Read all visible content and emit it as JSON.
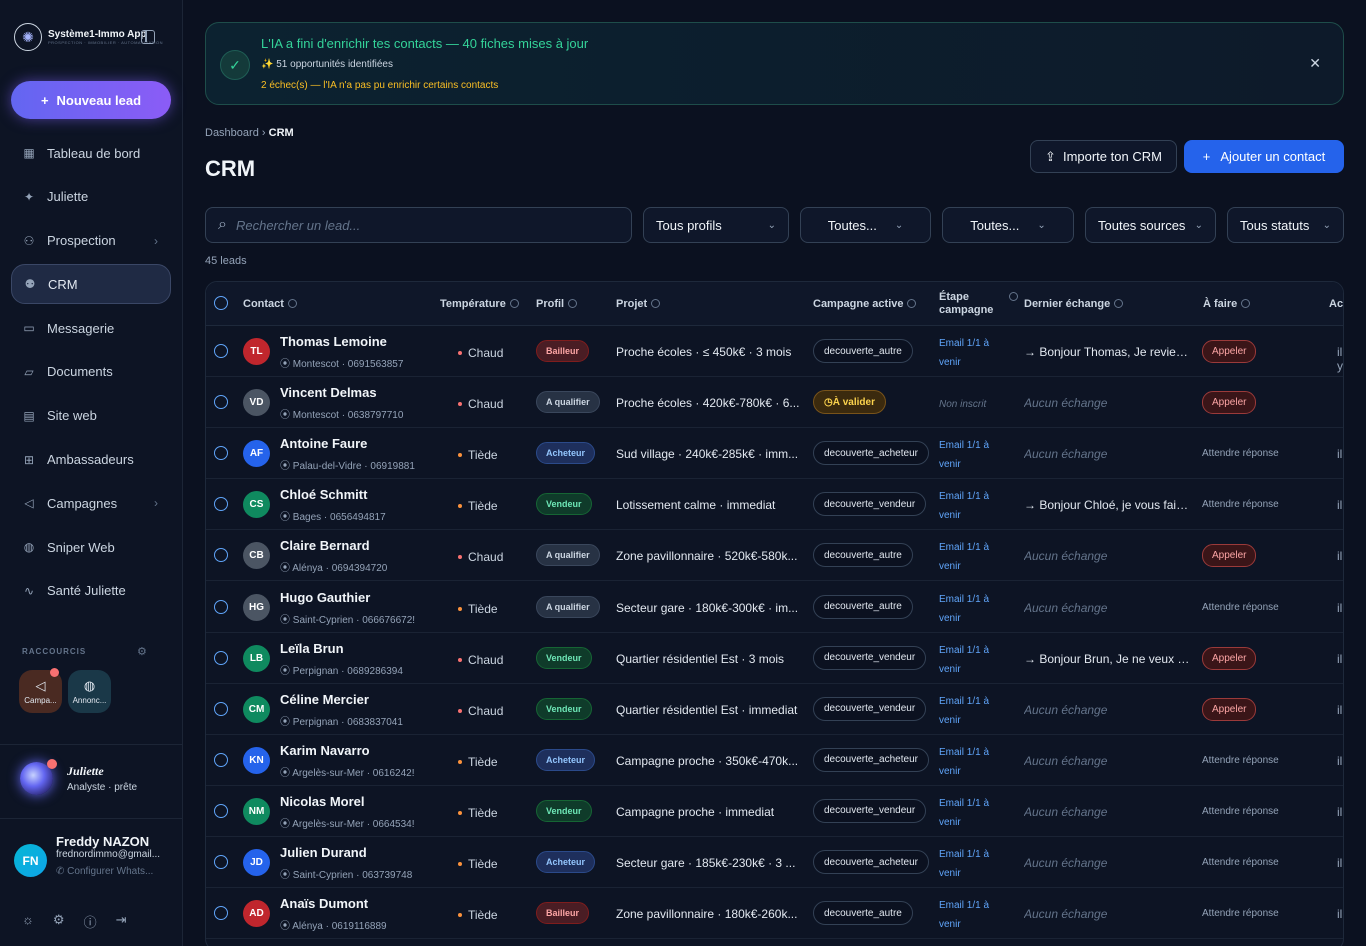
{
  "app": {
    "name": "Système1-Immo App",
    "tagline": "PROSPECTION · IMMOBILIER · AUTOMATISATION"
  },
  "sidebar": {
    "new_lead": "Nouveau lead",
    "items": [
      {
        "label": "Tableau de bord",
        "icon": "grid-icon"
      },
      {
        "label": "Juliette",
        "icon": "sparkle-icon"
      },
      {
        "label": "Prospection",
        "icon": "user-plus-icon"
      },
      {
        "label": "CRM",
        "icon": "users-icon"
      },
      {
        "label": "Messagerie",
        "icon": "message-icon"
      },
      {
        "label": "Documents",
        "icon": "folder-icon"
      },
      {
        "label": "Site web",
        "icon": "layout-icon"
      },
      {
        "label": "Ambassadeurs",
        "icon": "gift-icon"
      },
      {
        "label": "Campagnes",
        "icon": "megaphone-icon"
      },
      {
        "label": "Sniper Web",
        "icon": "globe-icon"
      },
      {
        "label": "Santé Juliette",
        "icon": "activity-icon"
      }
    ],
    "shortcuts_label": "RACCOURCIS",
    "shortcuts": [
      {
        "label": "Campa..."
      },
      {
        "label": "Annonc..."
      }
    ],
    "assistant": {
      "name": "Juliette",
      "status": "Analyste · prête"
    },
    "user": {
      "name": "Freddy NAZON",
      "email": "frednordimmo@gmail...",
      "initials": "FN",
      "whatsapp": "Configurer Whats..."
    }
  },
  "banner": {
    "title": "L'IA a fini d'enrichir tes contacts — 40 fiches mises à jour",
    "subtitle": "51 opportunités identifiées",
    "warning": "2 échec(s) — l'IA n'a pas pu enrichir certains contacts"
  },
  "breadcrumb": {
    "parent": "Dashboard",
    "current": "CRM"
  },
  "page": {
    "title": "CRM",
    "import_btn": "Importe ton CRM",
    "add_btn": "Ajouter un contact",
    "count": "45 leads"
  },
  "search": {
    "placeholder": "Rechercher un lead..."
  },
  "filters": {
    "profils": "Tous profils",
    "f2": "Toutes...",
    "f3": "Toutes...",
    "sources": "Toutes sources",
    "statuts": "Tous statuts"
  },
  "table": {
    "headers": {
      "contact": "Contact",
      "temperature": "Température",
      "profil": "Profil",
      "projet": "Projet",
      "campagne": "Campagne active",
      "etape_1": "Étape",
      "etape_2": "campagne",
      "dernier": "Dernier échange",
      "afaire": "À faire",
      "actions": "Ac"
    },
    "rows": [
      {
        "initials": "TL",
        "name": "Thomas Lemoine",
        "loc": "Montescot · 0691563857",
        "temp": "Chaud",
        "profil": "Bailleur",
        "projet": "Proche écoles · ≤ 450k€ · 3 mois",
        "campagne": "decouverte_autre",
        "etape": "Email 1/1 à venir",
        "dernier": "→ Bonjour Thomas, Je revien...",
        "afaire": "Appeler",
        "act": "il y"
      },
      {
        "initials": "VD",
        "name": "Vincent Delmas",
        "loc": "Montescot · 0638797710",
        "temp": "Chaud",
        "profil": "A qualifier",
        "projet": "Proche écoles · 420k€-780k€ · 6...",
        "campagne": "À valider",
        "etape": "Non inscrit",
        "dernier": "Aucun échange",
        "afaire": "Appeler",
        "act": ""
      },
      {
        "initials": "AF",
        "name": "Antoine Faure",
        "loc": "Palau-del-Vidre · 06919881",
        "temp": "Tiède",
        "profil": "Acheteur",
        "projet": "Sud village · 240k€-285k€ · imm...",
        "campagne": "decouverte_acheteur",
        "etape": "Email 1/1 à venir",
        "dernier": "Aucun échange",
        "afaire": "Attendre réponse",
        "act": "il"
      },
      {
        "initials": "CS",
        "name": "Chloé Schmitt",
        "loc": "Bages · 0656494817",
        "temp": "Tiède",
        "profil": "Vendeur",
        "projet": "Lotissement calme · immediat",
        "campagne": "decouverte_vendeur",
        "etape": "Email 1/1 à venir",
        "dernier": "→ Bonjour Chloé, je vous fais ...",
        "afaire": "Attendre réponse",
        "act": "il"
      },
      {
        "initials": "CB",
        "name": "Claire Bernard",
        "loc": "Alénya · 0694394720",
        "temp": "Chaud",
        "profil": "A qualifier",
        "projet": "Zone pavillonnaire · 520k€-580k...",
        "campagne": "decouverte_autre",
        "etape": "Email 1/1 à venir",
        "dernier": "Aucun échange",
        "afaire": "Appeler",
        "act": "il"
      },
      {
        "initials": "HG",
        "name": "Hugo Gauthier",
        "loc": "Saint-Cyprien · 066676672!",
        "temp": "Tiède",
        "profil": "A qualifier",
        "projet": "Secteur gare · 180k€-300k€ · im...",
        "campagne": "decouverte_autre",
        "etape": "Email 1/1 à venir",
        "dernier": "Aucun échange",
        "afaire": "Attendre réponse",
        "act": "il"
      },
      {
        "initials": "LB",
        "name": "Leïla Brun",
        "loc": "Perpignan · 0689286394",
        "temp": "Chaud",
        "profil": "Vendeur",
        "projet": "Quartier résidentiel Est · 3 mois",
        "campagne": "decouverte_vendeur",
        "etape": "Email 1/1 à venir",
        "dernier": "→ Bonjour Brun, Je ne veux p...",
        "afaire": "Appeler",
        "act": "il"
      },
      {
        "initials": "CM",
        "name": "Céline Mercier",
        "loc": "Perpignan · 0683837041",
        "temp": "Chaud",
        "profil": "Vendeur",
        "projet": "Quartier résidentiel Est · immediat",
        "campagne": "decouverte_vendeur",
        "etape": "Email 1/1 à venir",
        "dernier": "Aucun échange",
        "afaire": "Appeler",
        "act": "il"
      },
      {
        "initials": "KN",
        "name": "Karim Navarro",
        "loc": "Argelès-sur-Mer · 0616242!",
        "temp": "Tiède",
        "profil": "Acheteur",
        "projet": "Campagne proche · 350k€-470k...",
        "campagne": "decouverte_acheteur",
        "etape": "Email 1/1 à venir",
        "dernier": "Aucun échange",
        "afaire": "Attendre réponse",
        "act": "il"
      },
      {
        "initials": "NM",
        "name": "Nicolas Morel",
        "loc": "Argelès-sur-Mer · 0664534!",
        "temp": "Tiède",
        "profil": "Vendeur",
        "projet": "Campagne proche · immediat",
        "campagne": "decouverte_vendeur",
        "etape": "Email 1/1 à venir",
        "dernier": "Aucun échange",
        "afaire": "Attendre réponse",
        "act": "il"
      },
      {
        "initials": "JD",
        "name": "Julien Durand",
        "loc": "Saint-Cyprien · 063739748",
        "temp": "Tiède",
        "profil": "Acheteur",
        "projet": "Secteur gare · 185k€-230k€ · 3 ...",
        "campagne": "decouverte_acheteur",
        "etape": "Email 1/1 à venir",
        "dernier": "Aucun échange",
        "afaire": "Attendre réponse",
        "act": "il"
      },
      {
        "initials": "AD",
        "name": "Anaïs Dumont",
        "loc": "Alénya · 0619116889",
        "temp": "Tiède",
        "profil": "Bailleur",
        "projet": "Zone pavillonnaire · 180k€-260k...",
        "campagne": "decouverte_autre",
        "etape": "Email 1/1 à venir",
        "dernier": "Aucun échange",
        "afaire": "Attendre réponse",
        "act": "il"
      }
    ]
  },
  "colors": {
    "accent": "#2563eb",
    "success": "#34d399",
    "warning": "#fbbf24",
    "hot": "#f87171",
    "warm": "#fb923c"
  }
}
